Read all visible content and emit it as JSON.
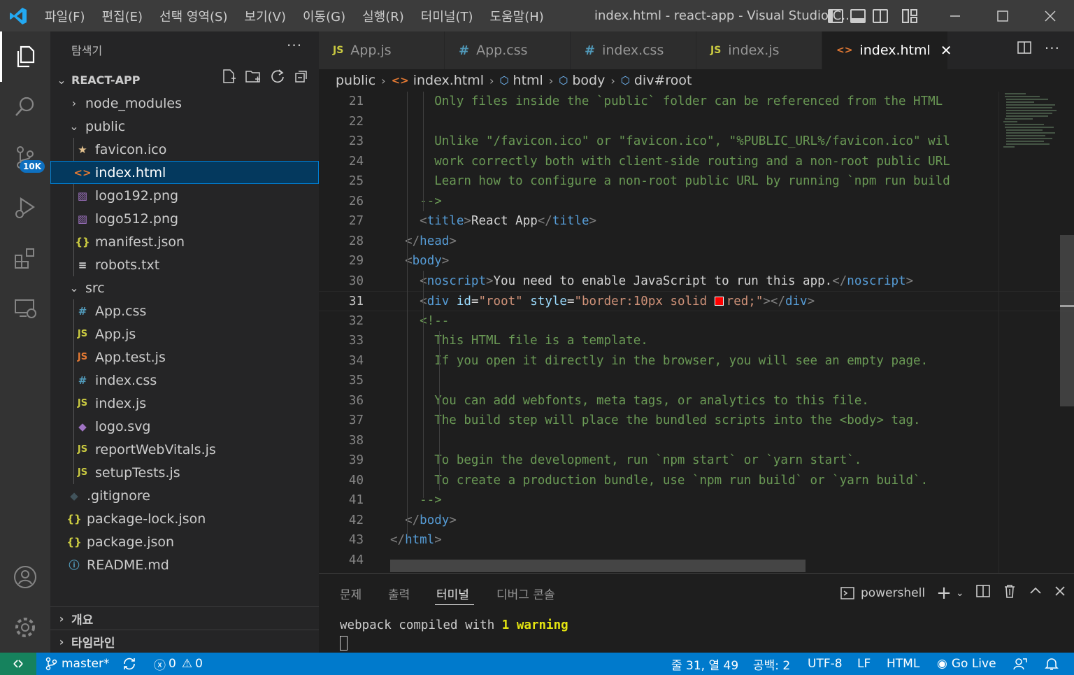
{
  "titlebar": {
    "menu": [
      "파일(F)",
      "편집(E)",
      "선택 영역(S)",
      "보기(V)",
      "이동(G)",
      "실행(R)",
      "터미널(T)",
      "도움말(H)"
    ],
    "title": "index.html - react-app - Visual Studio C..."
  },
  "activitybar": {
    "scm_badge": "10K"
  },
  "sidebar": {
    "header": "탐색기",
    "more": "···",
    "project": "REACT-APP",
    "items": [
      {
        "label": "node_modules",
        "icon": "chevron-right",
        "kind": "folder"
      },
      {
        "label": "public",
        "icon": "chevron-down",
        "kind": "folder"
      },
      {
        "label": "favicon.ico",
        "icon": "star-icon",
        "color": "#e2c08d"
      },
      {
        "label": "index.html",
        "icon": "html-icon",
        "color": "#e37933"
      },
      {
        "label": "logo192.png",
        "icon": "image-icon",
        "color": "#a074c4"
      },
      {
        "label": "logo512.png",
        "icon": "image-icon",
        "color": "#a074c4"
      },
      {
        "label": "manifest.json",
        "icon": "json-icon",
        "color": "#cbcb41"
      },
      {
        "label": "robots.txt",
        "icon": "text-icon",
        "color": "#cccccc"
      },
      {
        "label": "src",
        "icon": "chevron-down",
        "kind": "folder"
      },
      {
        "label": "App.css",
        "icon": "css-icon",
        "color": "#519aba"
      },
      {
        "label": "App.js",
        "icon": "js-icon",
        "color": "#cbcb41"
      },
      {
        "label": "App.test.js",
        "icon": "js-icon",
        "color": "#e37933"
      },
      {
        "label": "index.css",
        "icon": "css-icon",
        "color": "#519aba"
      },
      {
        "label": "index.js",
        "icon": "js-icon",
        "color": "#cbcb41"
      },
      {
        "label": "logo.svg",
        "icon": "svg-icon",
        "color": "#a074c4"
      },
      {
        "label": "reportWebVitals.js",
        "icon": "js-icon",
        "color": "#cbcb41"
      },
      {
        "label": "setupTests.js",
        "icon": "js-icon",
        "color": "#cbcb41"
      },
      {
        "label": ".gitignore",
        "icon": "git-icon",
        "color": "#41535b"
      },
      {
        "label": "package-lock.json",
        "icon": "json-icon",
        "color": "#cbcb41"
      },
      {
        "label": "package.json",
        "icon": "json-icon",
        "color": "#cbcb41"
      },
      {
        "label": "README.md",
        "icon": "info-icon",
        "color": "#519aba"
      }
    ],
    "outline": "개요",
    "timeline": "타임라인"
  },
  "tabs": [
    {
      "label": "App.js",
      "icon": "JS",
      "color": "#cbcb41"
    },
    {
      "label": "App.css",
      "icon": "#",
      "color": "#519aba"
    },
    {
      "label": "index.css",
      "icon": "#",
      "color": "#519aba"
    },
    {
      "label": "index.js",
      "icon": "JS",
      "color": "#cbcb41"
    },
    {
      "label": "index.html",
      "icon": "<>",
      "color": "#e37933"
    }
  ],
  "breadcrumb": [
    "public",
    "index.html",
    "html",
    "body",
    "div#root"
  ],
  "editor": {
    "current_line": 31,
    "lines": [
      {
        "n": "21",
        "text": "Only files inside the `public` folder can be referenced from the HTML"
      },
      {
        "n": "22",
        "text": ""
      },
      {
        "n": "23",
        "text": "Unlike \"/favicon.ico\" or \"favicon.ico\", \"%PUBLIC_URL%/favicon.ico\" wil"
      },
      {
        "n": "24",
        "text": "work correctly both with client-side routing and a non-root public URL"
      },
      {
        "n": "25",
        "text": "Learn how to configure a non-root public URL by running `npm run build"
      },
      {
        "n": "26",
        "text": "-->"
      },
      {
        "n": "27",
        "text": "<title>React App</title>"
      },
      {
        "n": "28",
        "text": "</head>"
      },
      {
        "n": "29",
        "text": "<body>"
      },
      {
        "n": "30",
        "text": "<noscript>You need to enable JavaScript to run this app.</noscript>"
      },
      {
        "n": "31",
        "text": "<div id=\"root\" style=\"border:10px solid red;\"></div>"
      },
      {
        "n": "32",
        "text": "<!--"
      },
      {
        "n": "33",
        "text": "This HTML file is a template."
      },
      {
        "n": "34",
        "text": "If you open it directly in the browser, you will see an empty page."
      },
      {
        "n": "35",
        "text": ""
      },
      {
        "n": "36",
        "text": "You can add webfonts, meta tags, or analytics to this file."
      },
      {
        "n": "37",
        "text": "The build step will place the bundled scripts into the <body> tag."
      },
      {
        "n": "38",
        "text": ""
      },
      {
        "n": "39",
        "text": "To begin the development, run `npm start` or `yarn start`."
      },
      {
        "n": "40",
        "text": "To create a production bundle, use `npm run build` or `yarn build`."
      },
      {
        "n": "41",
        "text": "-->"
      },
      {
        "n": "42",
        "text": "</body>"
      },
      {
        "n": "43",
        "text": "</html>"
      },
      {
        "n": "44",
        "text": ""
      }
    ]
  },
  "panel": {
    "tabs": [
      "문제",
      "출력",
      "터미널",
      "디버그 콘솔"
    ],
    "active_tab": "터미널",
    "shell": "powershell",
    "terminal_prefix": "webpack compiled with ",
    "terminal_count": "1",
    "terminal_warning": "warning"
  },
  "statusbar": {
    "branch": "master*",
    "errors": "0",
    "warnings": "0",
    "position": "줄 31, 열 49",
    "spaces": "공백: 2",
    "encoding": "UTF-8",
    "eol": "LF",
    "language": "HTML",
    "golive": "Go Live"
  }
}
